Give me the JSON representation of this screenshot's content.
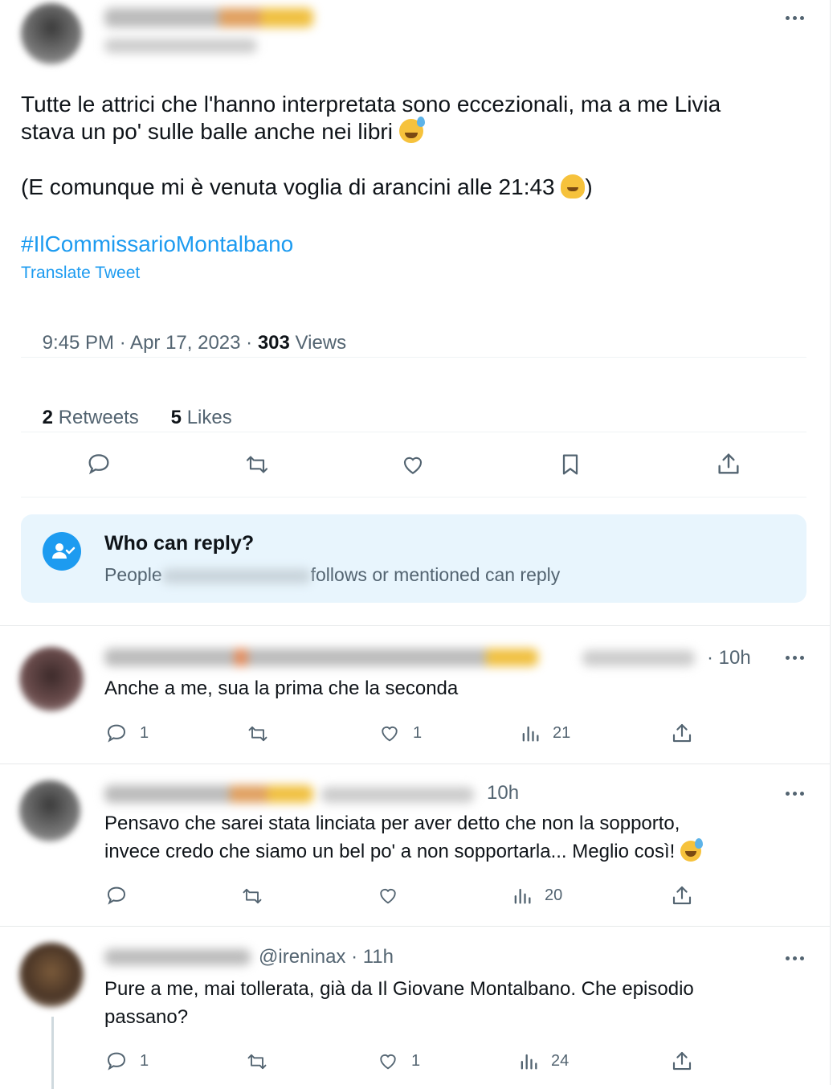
{
  "tweet": {
    "line1": "Tutte le attrici che l'hanno interpretata sono eccezionali, ma a me Livia",
    "line2": "stava un po' sulle balle anche nei libri",
    "line3": "(E comunque mi è venuta voglia di arancini alle 21:43",
    "line3_end": ")",
    "hashtag": "#IlCommissarioMontalbano",
    "translate": "Translate Tweet",
    "timestamp": "9:45 PM · Apr 17, 2023 · ",
    "views_count": "303",
    "views_label": " Views",
    "retweets_count": "2",
    "retweets_label": " Retweets",
    "likes_count": "5",
    "likes_label": " Likes"
  },
  "who_can_reply": {
    "title": "Who can reply?",
    "text_prefix": "People",
    "text_suffix": "follows or mentioned can reply"
  },
  "replies": [
    {
      "time": "· 10h",
      "text": "Anche a me, sua la prima che la seconda",
      "reply_count": "1",
      "like_count": "1",
      "views": "21"
    },
    {
      "time": "10h",
      "line1": "Pensavo che sarei stata linciata per aver detto che non la sopporto,",
      "line2": "invece credo che siamo un bel po' a non sopportarla... Meglio così!",
      "views": "20"
    },
    {
      "handle": "@ireninax · 11h",
      "line1": "Pure a me, mai tollerata, già da Il Giovane Montalbano. Che episodio",
      "line2": "passano?",
      "reply_count": "1",
      "like_count": "1",
      "views": "24"
    }
  ],
  "colors": {
    "link": "#1d9bf0",
    "secondary": "#536471",
    "banner_bg": "#e8f5fd"
  }
}
